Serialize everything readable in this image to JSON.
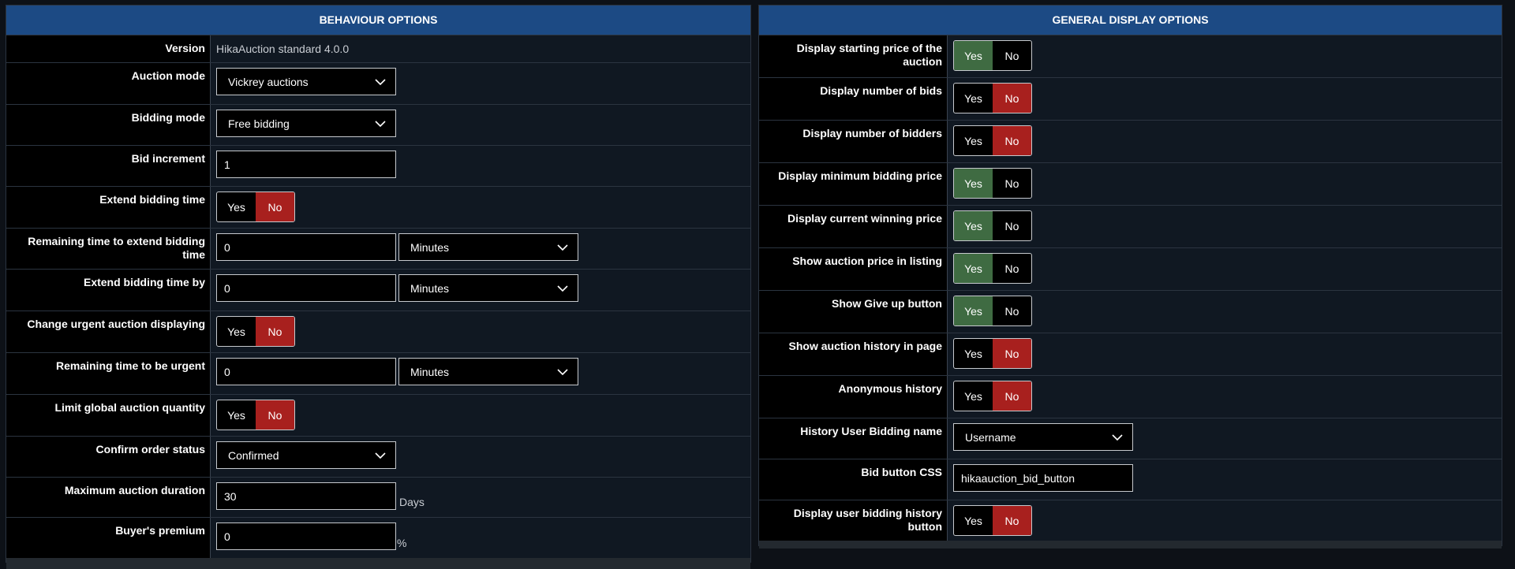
{
  "behaviour": {
    "title": "BEHAVIOUR OPTIONS",
    "version_label": "Version",
    "version_value": "HikaAuction standard 4.0.0",
    "auction_mode_label": "Auction mode",
    "auction_mode_value": "Vickrey auctions",
    "bidding_mode_label": "Bidding mode",
    "bidding_mode_value": "Free bidding",
    "bid_increment_label": "Bid increment",
    "bid_increment_value": "1",
    "extend_bidding_time_label": "Extend bidding time",
    "remaining_extend_label": "Remaining time to extend bidding time",
    "remaining_extend_value": "0",
    "remaining_extend_unit": "Minutes",
    "extend_by_label": "Extend bidding time by",
    "extend_by_value": "0",
    "extend_by_unit": "Minutes",
    "change_urgent_label": "Change urgent auction displaying",
    "remaining_urgent_label": "Remaining time to be urgent",
    "remaining_urgent_value": "0",
    "remaining_urgent_unit": "Minutes",
    "limit_global_label": "Limit global auction quantity",
    "confirm_status_label": "Confirm order status",
    "confirm_status_value": "Confirmed",
    "max_duration_label": "Maximum auction duration",
    "max_duration_value": "30",
    "max_duration_unit": "Days",
    "buyers_premium_label": "Buyer's premium",
    "buyers_premium_value": "0",
    "buyers_premium_unit": "%"
  },
  "display": {
    "title": "GENERAL DISPLAY OPTIONS",
    "starting_price_label": "Display starting price of the auction",
    "num_bids_label": "Display number of bids",
    "num_bidders_label": "Display number of bidders",
    "min_bidding_label": "Display minimum bidding price",
    "current_winning_label": "Display current winning price",
    "price_listing_label": "Show auction price in listing",
    "give_up_label": "Show Give up button",
    "history_page_label": "Show auction history in page",
    "anonymous_label": "Anonymous history",
    "history_name_label": "History User Bidding name",
    "history_name_value": "Username",
    "bid_css_label": "Bid button CSS",
    "bid_css_value": "hikaauction_bid_button",
    "user_history_label": "Display user bidding history button"
  },
  "toggle": {
    "yes": "Yes",
    "no": "No"
  },
  "colors": {
    "header": "#1c4a84",
    "yes_active": "#3f6b42",
    "no_active": "#a8201e"
  },
  "icons": {
    "dropdown": "chevron-down-icon"
  }
}
